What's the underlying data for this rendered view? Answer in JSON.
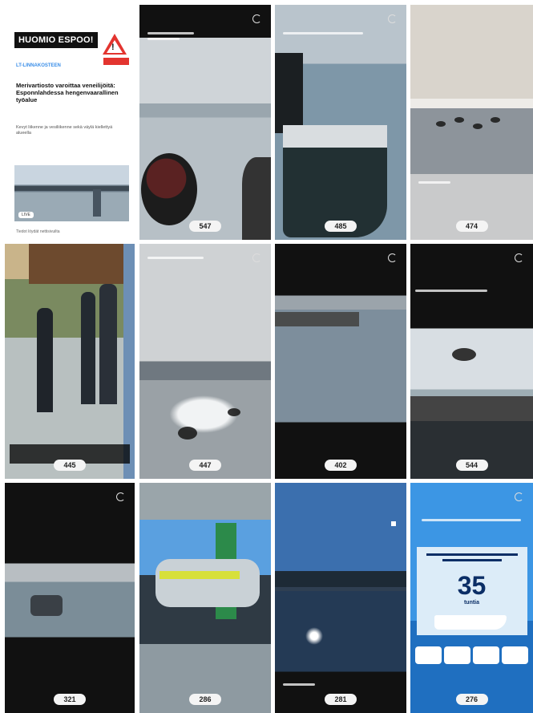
{
  "tiles": [
    {
      "id": "article",
      "tag": "HUOMIO ESPOO!",
      "kicker": "LT-LINNAKOSTEEN",
      "headline": "Merivartiosto varoittaa veneilijöitä: Esponnlahdessa hengenvaarallinen työalue",
      "lede": "Kevyt liikenne ja vesiliikenne sekä väylä kiellettyä alueella",
      "chip": "LIVE",
      "meta": "Tiedot löydät nettisivuilta",
      "views": ""
    },
    {
      "id": "ferry-window",
      "views": "547",
      "caption": ""
    },
    {
      "id": "ship-stern",
      "views": "485",
      "caption": ""
    },
    {
      "id": "boats-formation",
      "views": "474",
      "caption": ""
    },
    {
      "id": "stairs-tower",
      "views": "445",
      "caption": ""
    },
    {
      "id": "jetski-wake",
      "views": "447",
      "caption": ""
    },
    {
      "id": "pier-calm",
      "views": "402",
      "caption": ""
    },
    {
      "id": "helicopter-deck",
      "views": "544",
      "caption": ""
    },
    {
      "id": "harbor-boat",
      "views": "321",
      "caption": ""
    },
    {
      "id": "jetskis-trailer",
      "views": "286",
      "caption": ""
    },
    {
      "id": "sun-water",
      "views": "281",
      "caption": ""
    },
    {
      "id": "infographic",
      "number": "35",
      "unit": "tuntia",
      "views": "276"
    }
  ],
  "colors": {
    "accent_blue": "#3a8ee8",
    "warning_red": "#e3342f",
    "infographic_bg": "#2f8fe0"
  }
}
